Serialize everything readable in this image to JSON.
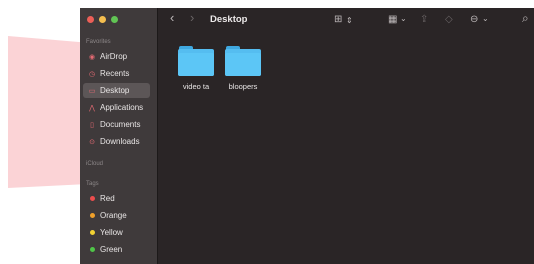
{
  "sidebar": {
    "favorites_label": "Favorites",
    "favorites": [
      {
        "label": "AirDrop",
        "icon": "airdrop-icon"
      },
      {
        "label": "Recents",
        "icon": "clock-icon"
      },
      {
        "label": "Desktop",
        "icon": "desktop-icon",
        "selected": true
      },
      {
        "label": "Applications",
        "icon": "applications-icon"
      },
      {
        "label": "Documents",
        "icon": "document-icon"
      },
      {
        "label": "Downloads",
        "icon": "download-icon"
      }
    ],
    "icloud_label": "iCloud",
    "tags_label": "Tags",
    "tags": [
      {
        "label": "Red",
        "color": "#ec4d4d"
      },
      {
        "label": "Orange",
        "color": "#f0a02a"
      },
      {
        "label": "Yellow",
        "color": "#f2d233"
      },
      {
        "label": "Green",
        "color": "#4fc548"
      }
    ]
  },
  "toolbar": {
    "title": "Desktop",
    "back_icon": "‹",
    "forward_icon": "›",
    "view_icon": "⊞",
    "view_chevron": "⇕",
    "group_icon": "▦",
    "group_chevron": "⌄",
    "share_icon": "⇪",
    "tag_icon": "◇",
    "action_icon": "⊖",
    "action_chevron": "⌄",
    "search_icon": "⌕"
  },
  "files": [
    {
      "name": "video ta",
      "icon": "folder-icon"
    },
    {
      "name": "bloopers",
      "icon": "folder-icon"
    }
  ],
  "colors": {
    "window_bg": "#2a2526",
    "sidebar_bg": "#3f3a3b",
    "sidebar_selected": "#5c5657",
    "folder": "#5cc6f6",
    "sidebar_icon": "#e46a73"
  }
}
